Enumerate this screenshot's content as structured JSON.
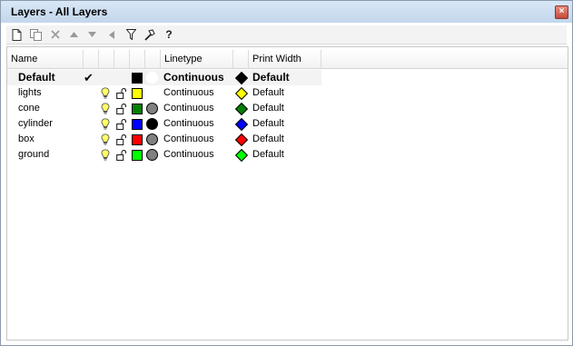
{
  "window": {
    "title": "Layers - All Layers",
    "close_glyph": "×"
  },
  "toolbar": {
    "buttons": [
      {
        "name": "new-layer-icon",
        "glyph": "🗋"
      },
      {
        "name": "new-sublayer-icon",
        "glyph": "⧉"
      },
      {
        "name": "delete-icon",
        "glyph": "✕"
      },
      {
        "name": "move-up-icon",
        "glyph": "▲"
      },
      {
        "name": "move-down-icon",
        "glyph": "▼"
      },
      {
        "name": "move-out-icon",
        "glyph": "◂"
      },
      {
        "name": "filter-icon",
        "glyph": "⛛"
      },
      {
        "name": "tools-icon",
        "glyph": "⚒"
      },
      {
        "name": "help-icon",
        "glyph": "?"
      }
    ]
  },
  "table": {
    "columns": {
      "name": "Name",
      "linetype": "Linetype",
      "print_width": "Print Width"
    },
    "default_row": {
      "name": "Default",
      "current_mark": "✔",
      "linetype": "Continuous",
      "print_width": "Default",
      "color": "#000000",
      "material": "#ffffff",
      "print_color": "#000000"
    },
    "rows": [
      {
        "name": "lights",
        "color": "#ffff00",
        "material": null,
        "linetype": "Continuous",
        "print_color": "#ffff00",
        "print_width": "Default"
      },
      {
        "name": "cone",
        "color": "#008000",
        "material": "#808080",
        "linetype": "Continuous",
        "print_color": "#008000",
        "print_width": "Default"
      },
      {
        "name": "cylinder",
        "color": "#0000ff",
        "material": "#000000",
        "linetype": "Continuous",
        "print_color": "#0000ff",
        "print_width": "Default"
      },
      {
        "name": "box",
        "color": "#ff0000",
        "material": "#808080",
        "linetype": "Continuous",
        "print_color": "#ff0000",
        "print_width": "Default"
      },
      {
        "name": "ground",
        "color": "#00ff00",
        "material": "#808080",
        "linetype": "Continuous",
        "print_color": "#00ff00",
        "print_width": "Default"
      }
    ]
  }
}
